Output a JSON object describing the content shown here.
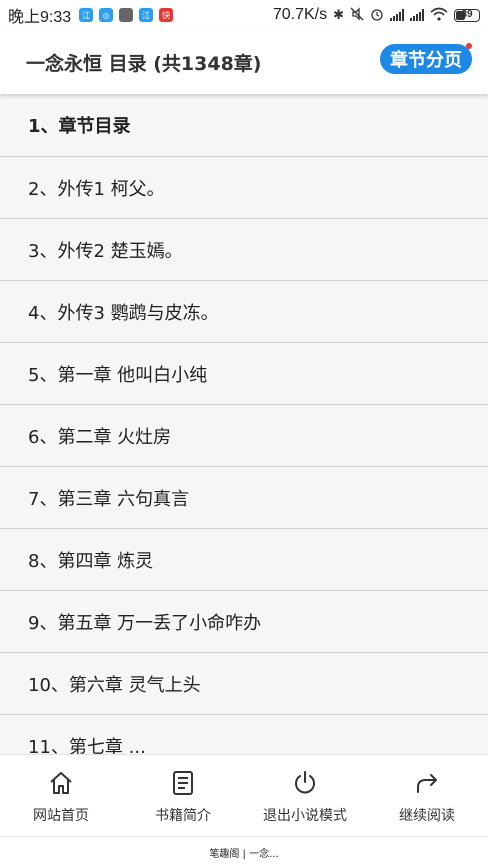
{
  "status_bar": {
    "time": "晚上9:33",
    "net_speed": "70.7K/s",
    "battery": "39",
    "notifications": [
      {
        "name": "app-notif-icon-1",
        "color": "#2a9df4",
        "glyph": "江"
      },
      {
        "name": "app-notif-icon-2",
        "color": "#2a9df4",
        "glyph": "◎"
      },
      {
        "name": "app-notif-icon-3",
        "color": "#666666",
        "glyph": ""
      },
      {
        "name": "app-notif-icon-4",
        "color": "#2a9df4",
        "glyph": "江"
      },
      {
        "name": "app-notif-icon-5",
        "color": "#e53935",
        "glyph": "快"
      }
    ]
  },
  "header": {
    "title": "一念永恒 目录 (共1348章)",
    "pager_button": "章节分页"
  },
  "chapters": [
    "1、章节目录",
    "2、外传1 柯父。",
    "3、外传2 楚玉嫣。",
    "4、外传3 鹦鹉与皮冻。",
    "5、第一章 他叫白小纯",
    "6、第二章 火灶房",
    "7、第三章 六句真言",
    "8、第四章 炼灵",
    "9、第五章 万一丢了小命咋办",
    "10、第六章 灵气上头",
    "11、第七章 ..."
  ],
  "bottom_nav": {
    "home": "网站首页",
    "intro": "书籍简介",
    "exit": "退出小说模式",
    "continue": "继续阅读"
  },
  "footer": "笔趣阁 | 一念..."
}
